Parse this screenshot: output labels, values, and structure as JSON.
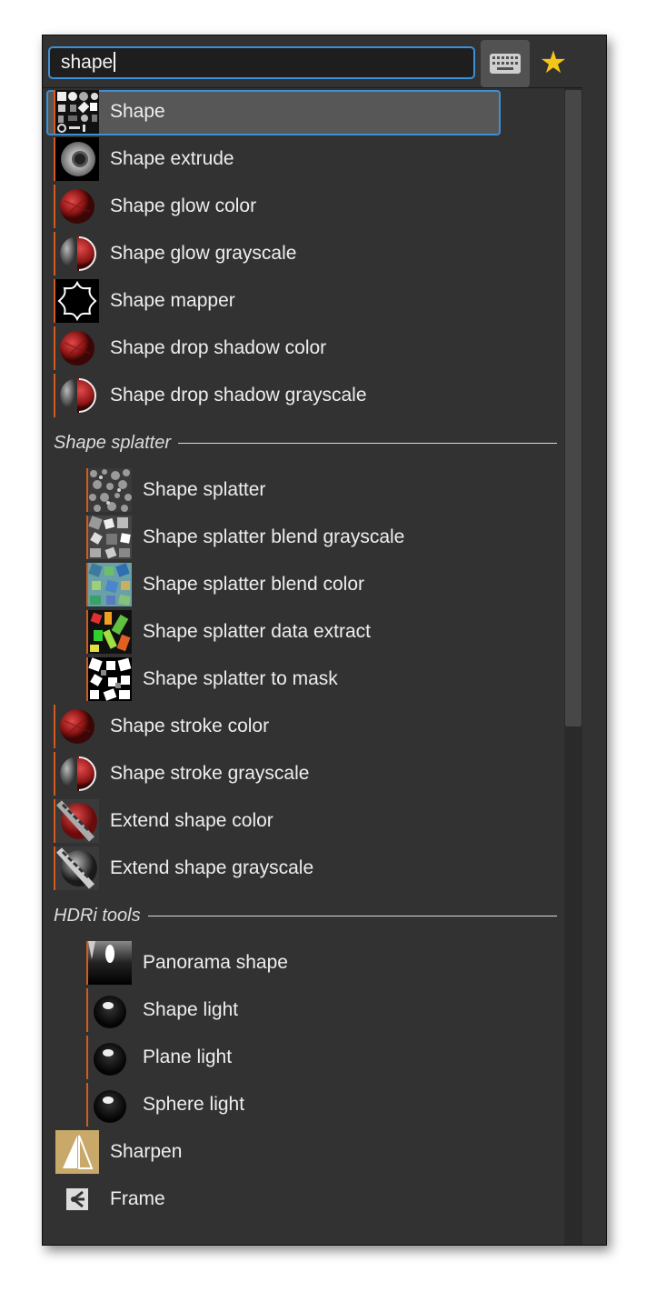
{
  "search": {
    "value": "shape"
  },
  "toolbar": {
    "keyboard_icon": "keyboard-icon",
    "favorite_icon": "star-icon",
    "favorite_color": "#f5c518"
  },
  "accent": "#3d8fd8",
  "marker_color": "#d45a1e",
  "items": [
    {
      "label": "Shape",
      "icon": "shape-atlas-icon",
      "selected": true
    },
    {
      "label": "Shape extrude",
      "icon": "shape-extrude-icon"
    },
    {
      "label": "Shape glow color",
      "icon": "red-sphere-icon"
    },
    {
      "label": "Shape glow grayscale",
      "icon": "half-gray-red-sphere-icon"
    },
    {
      "label": "Shape mapper",
      "icon": "star-outline-icon"
    },
    {
      "label": "Shape drop shadow color",
      "icon": "red-sphere-icon"
    },
    {
      "label": "Shape drop shadow grayscale",
      "icon": "half-gray-red-sphere-icon"
    }
  ],
  "sections": [
    {
      "title": "Shape splatter",
      "items": [
        {
          "label": "Shape splatter",
          "icon": "splatter-noise-icon"
        },
        {
          "label": "Shape splatter blend grayscale",
          "icon": "splatter-gray-icon"
        },
        {
          "label": "Shape splatter blend color",
          "icon": "splatter-color-icon"
        },
        {
          "label": "Shape splatter data extract",
          "icon": "splatter-data-icon"
        },
        {
          "label": "Shape splatter to mask",
          "icon": "splatter-mask-icon"
        }
      ]
    },
    {
      "title": "HDRi tools",
      "items": [
        {
          "label": "Panorama shape",
          "icon": "panorama-icon"
        },
        {
          "label": "Shape light",
          "icon": "light-sphere-icon"
        },
        {
          "label": "Plane light",
          "icon": "light-sphere-icon"
        },
        {
          "label": "Sphere light",
          "icon": "light-sphere-icon"
        }
      ]
    }
  ],
  "items_after_splatter": [
    {
      "label": "Shape stroke color",
      "icon": "red-sphere-icon"
    },
    {
      "label": "Shape stroke grayscale",
      "icon": "half-gray-red-sphere-icon"
    },
    {
      "label": "Extend shape color",
      "icon": "extend-red-icon"
    },
    {
      "label": "Extend shape grayscale",
      "icon": "extend-gray-icon"
    }
  ],
  "items_after_hdri": [
    {
      "label": "Sharpen",
      "icon": "sharpen-icon"
    },
    {
      "label": "Frame",
      "icon": "frame-icon"
    }
  ]
}
